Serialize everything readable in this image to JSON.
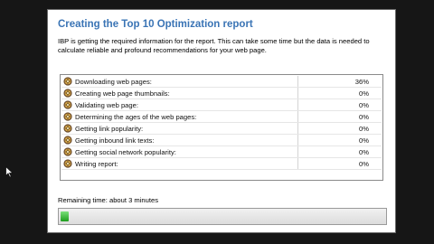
{
  "dialog": {
    "title": "Creating the Top 10 Optimization report",
    "description": "IBP is getting the required information for the report. This can take some time but the data is needed to calculate reliable and profound recommendations for your web page."
  },
  "tasks": [
    {
      "label": "Downloading web pages:",
      "percent": "36%"
    },
    {
      "label": "Creating web page thumbnails:",
      "percent": "0%"
    },
    {
      "label": "Validating web page:",
      "percent": "0%"
    },
    {
      "label": "Determining the ages of the web pages:",
      "percent": "0%"
    },
    {
      "label": "Getting link popularity:",
      "percent": "0%"
    },
    {
      "label": "Getting inbound link texts:",
      "percent": "0%"
    },
    {
      "label": "Getting social network popularity:",
      "percent": "0%"
    },
    {
      "label": "Writing report:",
      "percent": "0%"
    }
  ],
  "status": {
    "remaining_text": "Remaining time: about 3 minutes",
    "progress_fraction": 0.025
  },
  "icons": {
    "task_icon": "gear-cog-icon",
    "cursor": "mouse-pointer-icon"
  },
  "colors": {
    "title": "#3a74b5",
    "progress_fill": "#1d9d1d"
  }
}
